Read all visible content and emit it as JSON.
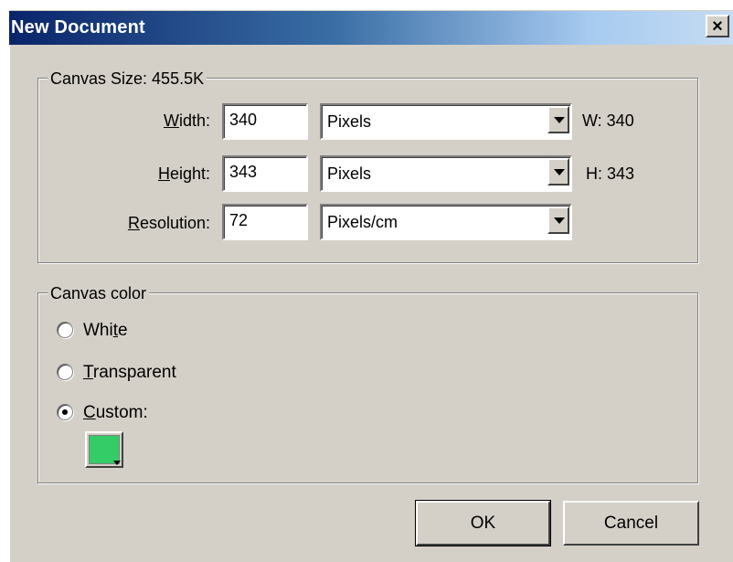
{
  "window": {
    "title": "New Document",
    "close_label": "×"
  },
  "canvas_size": {
    "legend": "Canvas Size: 455.5K",
    "rows": [
      {
        "label_prefix": "",
        "label_mnemonic": "W",
        "label_rest": "idth:",
        "value": "340",
        "unit": "Pixels",
        "info": "W: 340"
      },
      {
        "label_prefix": "",
        "label_mnemonic": "H",
        "label_rest": "eight:",
        "value": "343",
        "unit": "Pixels",
        "info": "H: 343"
      },
      {
        "label_prefix": "",
        "label_mnemonic": "R",
        "label_rest": "esolution:",
        "value": "72",
        "unit": "Pixels/cm",
        "info": ""
      }
    ]
  },
  "canvas_color": {
    "legend": "Canvas color",
    "options": [
      {
        "pre": "Whi",
        "mnemonic": "t",
        "post": "e",
        "checked": false
      },
      {
        "pre": "",
        "mnemonic": "T",
        "post": "ransparent",
        "checked": false
      },
      {
        "pre": "",
        "mnemonic": "C",
        "post": "ustom:",
        "checked": true
      }
    ],
    "custom_color": "#33cc66"
  },
  "buttons": {
    "ok": "OK",
    "cancel": "Cancel"
  }
}
